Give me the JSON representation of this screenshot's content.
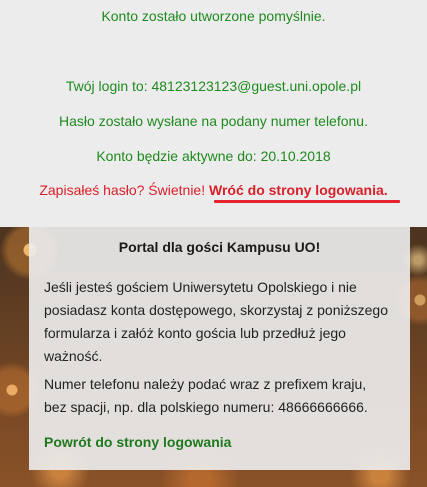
{
  "status": {
    "created": "Konto zostało utworzone pomyślnie.",
    "login_prefix": "Twój login to: ",
    "login_value": "48123123123@guest.uni.opole.pl",
    "password_sent": "Hasło zostało wysłane na podany numer telefonu.",
    "active_until_prefix": "Konto będzie aktywne do: ",
    "active_until_date": "20.10.2018",
    "remember_text": "Zapisałeś hasło? Świetnie! ",
    "back_to_login_link": "Wróć do strony logowania."
  },
  "info_box": {
    "title": "Portal dla gości Kampusu UO!",
    "para1": "Jeśli jesteś gościem Uniwersytetu Opolskiego i nie posiadasz konta dostępowego, skorzystaj z poniższego formularza i załóż konto gościa lub przedłuż jego ważność.",
    "para2": "Numer telefonu należy podać wraz z prefixem kraju, bez spacji, np. dla polskiego numeru: 48666666666.",
    "back_link": "Powrót do strony logowania"
  },
  "colors": {
    "success_green": "#1f8a1f",
    "alert_red": "#d9202a",
    "panel_bg": "#ececec"
  }
}
